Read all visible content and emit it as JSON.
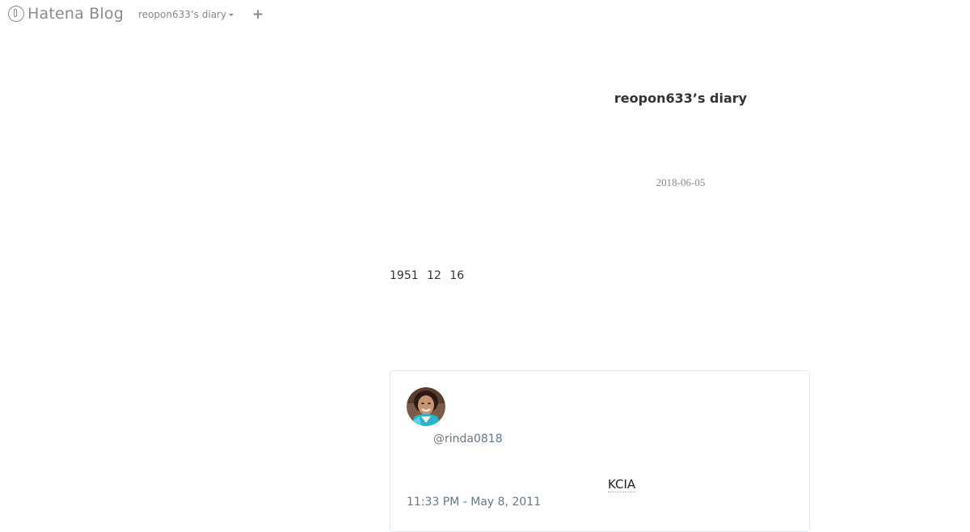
{
  "header": {
    "logo_text": "Hatena Blog",
    "blog_switcher_label": "reopon633’s diary",
    "add_label": "+",
    "icons": {
      "logo": "hatena-logo-icon",
      "caret": "caret-down-icon",
      "add": "plus-icon"
    }
  },
  "blog": {
    "title": "reopon633’s diary"
  },
  "entry": {
    "date": "2018-06-05",
    "body_text": "1951 12 16"
  },
  "tweet": {
    "handle": "@rinda0818",
    "text": "KCIA",
    "timestamp": "11:33 PM - May 8, 2011",
    "avatar_icon": "user-avatar"
  },
  "colors": {
    "muted": "#888888",
    "text": "#333333",
    "tweet_border": "#e1e8ed",
    "tweet_meta": "#657786"
  }
}
